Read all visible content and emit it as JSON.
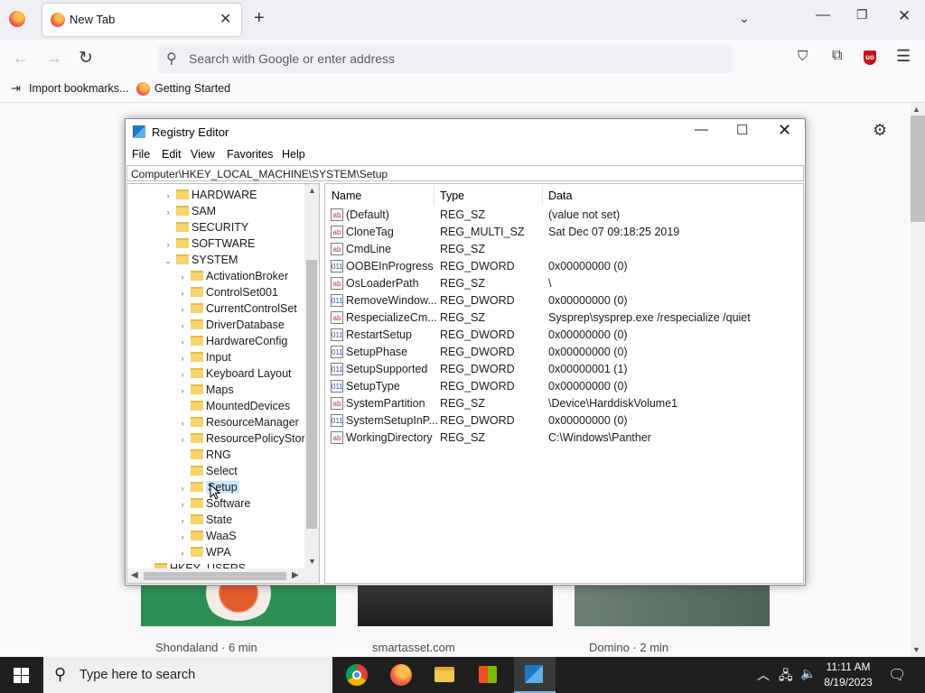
{
  "browser": {
    "tab_title": "New Tab",
    "url_placeholder": "Search with Google or enter address",
    "bookmarks": [
      "Import bookmarks...",
      "Getting Started"
    ]
  },
  "page": {
    "cards": [
      "Shondaland · 6 min",
      "smartasset.com",
      "Domino · 2 min"
    ]
  },
  "regedit": {
    "title": "Registry Editor",
    "menu": [
      "File",
      "Edit",
      "View",
      "Favorites",
      "Help"
    ],
    "address": "Computer\\HKEY_LOCAL_MACHINE\\SYSTEM\\Setup",
    "tree": [
      {
        "label": "HARDWARE",
        "level": 1,
        "arrow": "›"
      },
      {
        "label": "SAM",
        "level": 1,
        "arrow": "›"
      },
      {
        "label": "SECURITY",
        "level": 1,
        "arrow": ""
      },
      {
        "label": "SOFTWARE",
        "level": 1,
        "arrow": "›"
      },
      {
        "label": "SYSTEM",
        "level": 1,
        "arrow": "⌄"
      },
      {
        "label": "ActivationBroker",
        "level": 2,
        "arrow": "›"
      },
      {
        "label": "ControlSet001",
        "level": 2,
        "arrow": "›"
      },
      {
        "label": "CurrentControlSet",
        "level": 2,
        "arrow": "›"
      },
      {
        "label": "DriverDatabase",
        "level": 2,
        "arrow": "›"
      },
      {
        "label": "HardwareConfig",
        "level": 2,
        "arrow": "›"
      },
      {
        "label": "Input",
        "level": 2,
        "arrow": "›"
      },
      {
        "label": "Keyboard Layout",
        "level": 2,
        "arrow": "›"
      },
      {
        "label": "Maps",
        "level": 2,
        "arrow": "›"
      },
      {
        "label": "MountedDevices",
        "level": 2,
        "arrow": ""
      },
      {
        "label": "ResourceManager",
        "level": 2,
        "arrow": "›"
      },
      {
        "label": "ResourcePolicyStore",
        "level": 2,
        "arrow": "›"
      },
      {
        "label": "RNG",
        "level": 2,
        "arrow": ""
      },
      {
        "label": "Select",
        "level": 2,
        "arrow": ""
      },
      {
        "label": "Setup",
        "level": 2,
        "arrow": "›",
        "selected": true
      },
      {
        "label": "Software",
        "level": 2,
        "arrow": "›"
      },
      {
        "label": "State",
        "level": 2,
        "arrow": "›"
      },
      {
        "label": "WaaS",
        "level": 2,
        "arrow": "›"
      },
      {
        "label": "WPA",
        "level": 2,
        "arrow": "›"
      },
      {
        "label": "HKEY_USERS",
        "level": 0,
        "arrow": "›"
      }
    ],
    "columns": [
      "Name",
      "Type",
      "Data"
    ],
    "values": [
      {
        "name": "(Default)",
        "type": "REG_SZ",
        "data": "(value not set)",
        "kind": "sz"
      },
      {
        "name": "CloneTag",
        "type": "REG_MULTI_SZ",
        "data": "Sat Dec 07 09:18:25 2019",
        "kind": "sz"
      },
      {
        "name": "CmdLine",
        "type": "REG_SZ",
        "data": "",
        "kind": "sz"
      },
      {
        "name": "OOBEInProgress",
        "type": "REG_DWORD",
        "data": "0x00000000 (0)",
        "kind": "dw"
      },
      {
        "name": "OsLoaderPath",
        "type": "REG_SZ",
        "data": "\\",
        "kind": "sz"
      },
      {
        "name": "RemoveWindow...",
        "type": "REG_DWORD",
        "data": "0x00000000 (0)",
        "kind": "dw"
      },
      {
        "name": "RespecializeCm...",
        "type": "REG_SZ",
        "data": "Sysprep\\sysprep.exe /respecialize /quiet",
        "kind": "sz"
      },
      {
        "name": "RestartSetup",
        "type": "REG_DWORD",
        "data": "0x00000000 (0)",
        "kind": "dw"
      },
      {
        "name": "SetupPhase",
        "type": "REG_DWORD",
        "data": "0x00000000 (0)",
        "kind": "dw"
      },
      {
        "name": "SetupSupported",
        "type": "REG_DWORD",
        "data": "0x00000001 (1)",
        "kind": "dw"
      },
      {
        "name": "SetupType",
        "type": "REG_DWORD",
        "data": "0x00000000 (0)",
        "kind": "dw"
      },
      {
        "name": "SystemPartition",
        "type": "REG_SZ",
        "data": "\\Device\\HarddiskVolume1",
        "kind": "sz"
      },
      {
        "name": "SystemSetupInP...",
        "type": "REG_DWORD",
        "data": "0x00000000 (0)",
        "kind": "dw"
      },
      {
        "name": "WorkingDirectory",
        "type": "REG_SZ",
        "data": "C:\\Windows\\Panther",
        "kind": "sz"
      }
    ],
    "icon_labels": {
      "sz": "ab",
      "dw": "011"
    }
  },
  "taskbar": {
    "search_placeholder": "Type here to search",
    "time": "11:11 AM",
    "date": "8/19/2023"
  }
}
